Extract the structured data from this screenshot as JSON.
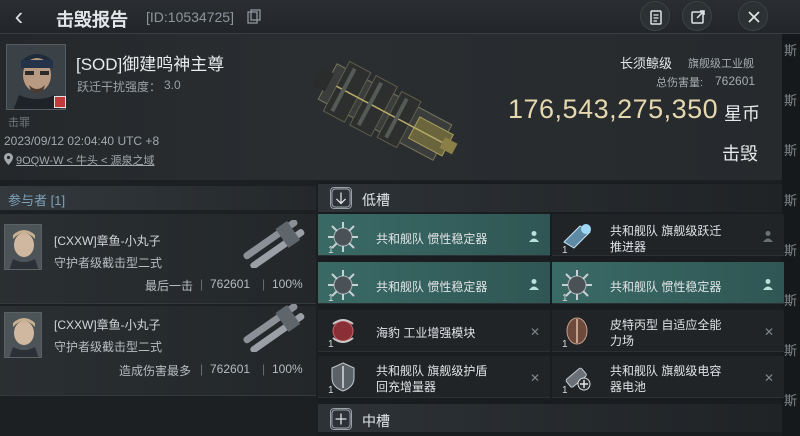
{
  "header": {
    "title": "击毁报告",
    "report_id": "[ID:10534725]"
  },
  "victim": {
    "name": "[SOD]御建鸣神主尊",
    "jump_label": "跃迁干扰强度：",
    "jump_value": "3.0",
    "corp_tag": "击罪",
    "timestamp": "2023/09/12 02:04:40 UTC +8",
    "location": "9OQW-W < 牛头 < 源泉之域"
  },
  "ship": {
    "name": "长须鲸级",
    "class": "旗舰级工业舰",
    "damage_label": "总伤害量:",
    "damage_value": "762601",
    "isk_value": "176,543,275,350",
    "isk_unit": "星币",
    "result": "击毁"
  },
  "participants": {
    "title": "参与者 [1]",
    "items": [
      {
        "name": "[CXXW]章鱼-小丸子",
        "ship": "守护者级截击型二式",
        "label": "最后一击",
        "damage": "762601",
        "percent": "100%"
      },
      {
        "name": "[CXXW]章鱼-小丸子",
        "ship": "守护者级截击型二式",
        "label": "造成伤害最多",
        "damage": "762601",
        "percent": "100%"
      }
    ]
  },
  "fitting": {
    "low_title": "低槽",
    "mid_title": "中槽",
    "modules": [
      {
        "qty": "1",
        "line1": "共和舰队 惯性稳定器",
        "line2": "",
        "highlight": true,
        "flag": "person"
      },
      {
        "qty": "1",
        "line1": "共和舰队 旗舰级跃迁",
        "line2": "推进器",
        "highlight": false,
        "flag": "person-dim"
      },
      {
        "qty": "1",
        "line1": "共和舰队 惯性稳定器",
        "line2": "",
        "highlight": true,
        "flag": "person"
      },
      {
        "qty": "1",
        "line1": "共和舰队 惯性稳定器",
        "line2": "",
        "highlight": true,
        "flag": "person"
      },
      {
        "qty": "1",
        "line1": "海豹 工业增强模块",
        "line2": "",
        "highlight": false,
        "flag": "x"
      },
      {
        "qty": "1",
        "line1": "皮特丙型 自适应全能",
        "line2": "力场",
        "highlight": false,
        "flag": "x"
      },
      {
        "qty": "1",
        "line1": "共和舰队 旗舰级护盾",
        "line2": "回充增量器",
        "highlight": false,
        "flag": "x"
      },
      {
        "qty": "1",
        "line1": "共和舰队 旗舰级电容",
        "line2": "器电池",
        "highlight": false,
        "flag": "x"
      }
    ]
  },
  "edge_chars": [
    "斯",
    "斯",
    "斯",
    "斯",
    "斯",
    "斯",
    "斯",
    "斯"
  ],
  "colors": {
    "accent_teal": "#3a6a66",
    "isk_gold": "#e6d8ae",
    "background": "#1c1f22"
  }
}
